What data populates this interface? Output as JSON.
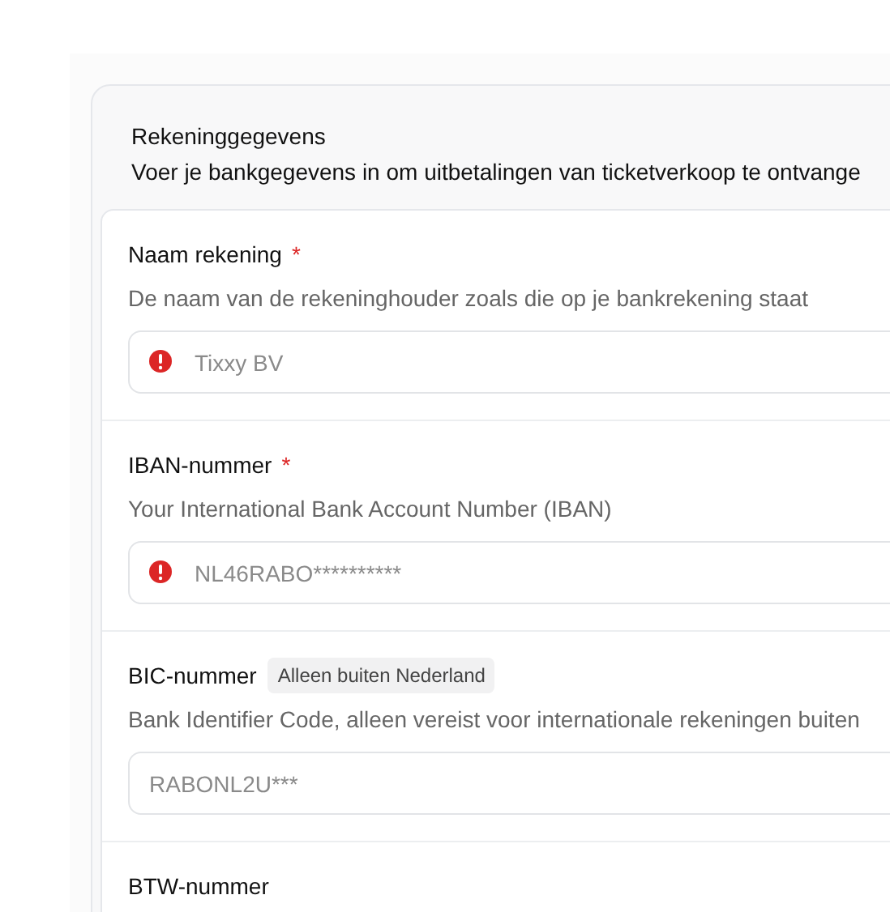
{
  "card": {
    "title": "Rekeninggegevens",
    "subtitle": "Voer je bankgegevens in om uitbetalingen van ticketverkoop te ontvange"
  },
  "fields": [
    {
      "label": "Naam rekening",
      "required_mark": "*",
      "description": "De naam van de rekeninghouder zoals die op je bankrekening staat",
      "placeholder": "Tixxy BV",
      "error": true
    },
    {
      "label": "IBAN-nummer",
      "required_mark": "*",
      "description": "Your International Bank Account Number (IBAN)",
      "placeholder": "NL46RABO**********",
      "error": true
    },
    {
      "label": "BIC-nummer",
      "badge": "Alleen buiten Nederland",
      "description": "Bank Identifier Code, alleen vereist voor internationale rekeningen buiten",
      "placeholder": "RABONL2U***",
      "error": false
    },
    {
      "label": "BTW-nummer"
    }
  ]
}
